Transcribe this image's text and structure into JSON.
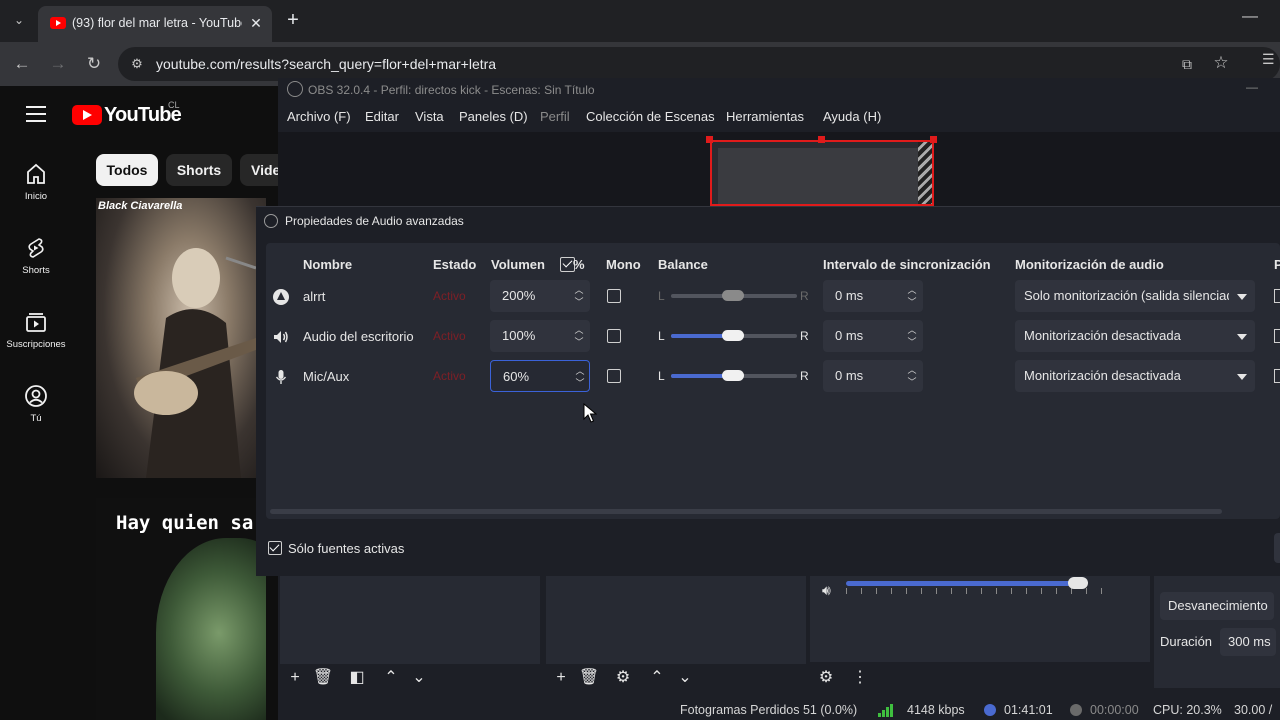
{
  "browser": {
    "tab_title": "(93) flor del mar letra - YouTube",
    "tab_close": "✕",
    "new_tab": "+",
    "tab_list": "⌄",
    "minimize": "—",
    "nav_back": "←",
    "nav_forward": "→",
    "nav_reload": "↻",
    "url": "youtube.com/results?search_query=flor+del+mar+letra",
    "icons": [
      "tab-list-icon",
      "youtube-favicon",
      "back-arrow-icon",
      "forward-arrow-icon",
      "reload-icon",
      "site-info-icon",
      "install-app-icon",
      "star-icon",
      "menu-icon"
    ]
  },
  "youtube": {
    "wordmark": "YouTube",
    "country": "CL",
    "sidebar": [
      {
        "label": "Inicio",
        "icon": "home-icon"
      },
      {
        "label": "Shorts",
        "icon": "shorts-icon"
      },
      {
        "label": "Suscripciones",
        "icon": "subscriptions-icon"
      },
      {
        "label": "Tú",
        "icon": "you-icon"
      }
    ],
    "chips": [
      "Todos",
      "Shorts",
      "Vide"
    ],
    "thumb1_caption": "Black Ciavarella",
    "thumb2_text": "Hay quien sa"
  },
  "obs": {
    "title": "OBS 32.0.4 - Perfil: directos kick - Escenas: Sin Título",
    "menu": [
      "Archivo (F)",
      "Editar",
      "Vista",
      "Paneles (D)",
      "Perfil",
      "Colección de Escenas",
      "Herramientas",
      "Ayuda (H)"
    ],
    "transitions": {
      "fade": "Desvanecimiento",
      "duration_label": "Duración",
      "duration": "300 ms"
    },
    "status": {
      "dropped": "Fotogramas Perdidos 51 (0.0%)",
      "kbps": "4148 kbps",
      "stream_time": "01:41:01",
      "rec_time": "00:00:00",
      "cpu": "CPU: 20.3%",
      "fps": "30.00 /"
    },
    "accent_color": "#4a6ad0",
    "selection_color": "#e01b1b"
  },
  "dialog": {
    "title": "Propiedades de Audio avanzadas",
    "headers": {
      "name": "Nombre",
      "state": "Estado",
      "volume": "Volumen",
      "percent": "%",
      "mono": "Mono",
      "balance": "Balance",
      "sync": "Intervalo de sincronización",
      "monitoring": "Monitorización de audio",
      "extra": "P"
    },
    "volume_percent_checked": true,
    "balance_L": "L",
    "balance_R": "R",
    "rows": [
      {
        "icon": "alert-source-icon",
        "name": "alrrt",
        "state": "Activo",
        "volume": "200%",
        "mono": false,
        "balance": 0.5,
        "sync": "0 ms",
        "monitoring": "Solo monitorización (salida silenciada)",
        "balance_enabled": false
      },
      {
        "icon": "speaker-icon",
        "name": "Audio del escritorio",
        "state": "Activo",
        "volume": "100%",
        "mono": false,
        "balance": 0.5,
        "sync": "0 ms",
        "monitoring": "Monitorización desactivada",
        "balance_enabled": true
      },
      {
        "icon": "microphone-icon",
        "name": "Mic/Aux",
        "state": "Activo",
        "volume": "60%",
        "mono": false,
        "balance": 0.5,
        "sync": "0 ms",
        "monitoring": "Monitorización desactivada",
        "balance_enabled": true
      }
    ],
    "only_active_label": "Sólo fuentes activas",
    "only_active_checked": true
  }
}
